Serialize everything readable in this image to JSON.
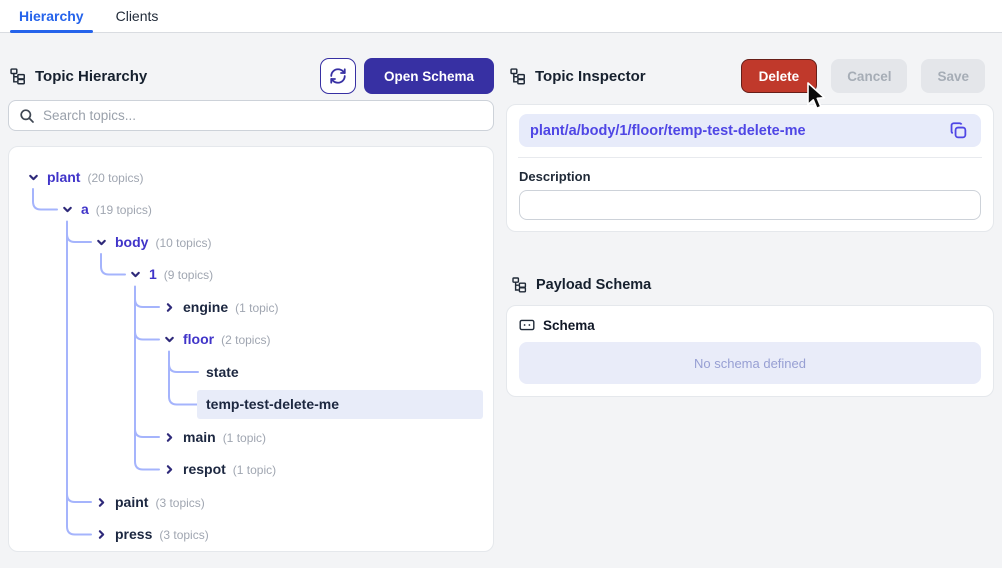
{
  "tabs": {
    "hierarchy": "Hierarchy",
    "clients": "Clients"
  },
  "left_panel": {
    "title": "Topic Hierarchy",
    "open_schema_label": "Open Schema",
    "search_placeholder": "Search topics...",
    "tree": {
      "nodes": [
        {
          "label": "plant",
          "count": "(20 topics)",
          "level": 0,
          "state": "expanded"
        },
        {
          "label": "a",
          "count": "(19 topics)",
          "level": 1,
          "state": "expanded"
        },
        {
          "label": "body",
          "count": "(10 topics)",
          "level": 2,
          "state": "expanded"
        },
        {
          "label": "1",
          "count": "(9 topics)",
          "level": 3,
          "state": "expanded"
        },
        {
          "label": "engine",
          "count": "(1 topic)",
          "level": 4,
          "state": "collapsed"
        },
        {
          "label": "floor",
          "count": "(2 topics)",
          "level": 4,
          "state": "expanded"
        },
        {
          "label": "state",
          "count": "",
          "level": 5,
          "state": "leaf"
        },
        {
          "label": "temp-test-delete-me",
          "count": "",
          "level": 5,
          "state": "leaf",
          "selected": true
        },
        {
          "label": "main",
          "count": "(1 topic)",
          "level": 4,
          "state": "collapsed"
        },
        {
          "label": "respot",
          "count": "(1 topic)",
          "level": 4,
          "state": "collapsed"
        },
        {
          "label": "paint",
          "count": "(3 topics)",
          "level": 2,
          "state": "collapsed"
        },
        {
          "label": "press",
          "count": "(3 topics)",
          "level": 2,
          "state": "collapsed"
        }
      ]
    }
  },
  "right_panel": {
    "title": "Topic Inspector",
    "delete_label": "Delete",
    "cancel_label": "Cancel",
    "save_label": "Save",
    "topic_path": "plant/a/body/1/floor/temp-test-delete-me",
    "description_label": "Description",
    "description_value": "",
    "payload_schema_title": "Payload Schema",
    "schema_label": "Schema",
    "no_schema_text": "No schema defined"
  },
  "colors": {
    "tab_active": "#2563eb",
    "primary_button": "#3730a3",
    "delete_button": "#c0392b",
    "tree_expanded_label": "#4034c9",
    "tree_node_label": "#1c2740",
    "connector_line": "#a5b4fc",
    "selection_highlight": "#e8ecf9",
    "path_chip_bg": "#e7ebfa",
    "path_text": "#4f46e5"
  }
}
